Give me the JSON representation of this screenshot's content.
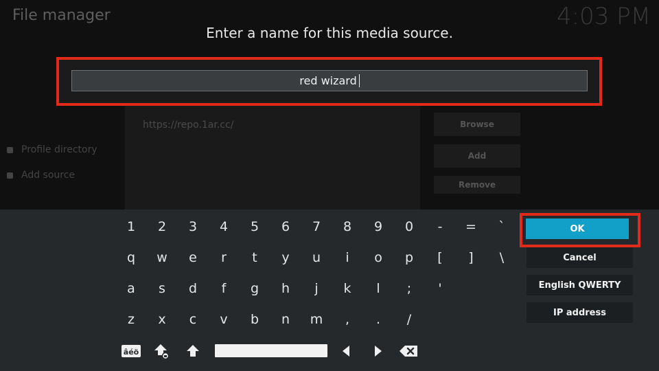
{
  "background": {
    "title": "File manager",
    "clock": "4:03 PM",
    "sidebar": [
      "Profile directory",
      "Add source"
    ],
    "source_url": "https://repo.1ar.cc/",
    "buttons": [
      "Browse",
      "Add",
      "Remove"
    ]
  },
  "dialog": {
    "heading": "Enter a name for this media source.",
    "input_value": "red wizard"
  },
  "keyboard": {
    "rows": [
      [
        "1",
        "2",
        "3",
        "4",
        "5",
        "6",
        "7",
        "8",
        "9",
        "0",
        "-",
        "=",
        "`"
      ],
      [
        "q",
        "w",
        "e",
        "r",
        "t",
        "y",
        "u",
        "i",
        "o",
        "p",
        "[",
        "]",
        "\\"
      ],
      [
        "a",
        "s",
        "d",
        "f",
        "g",
        "h",
        "j",
        "k",
        "l",
        ";",
        "'"
      ],
      [
        "z",
        "x",
        "c",
        "v",
        "b",
        "n",
        "m",
        ",",
        ".",
        "/"
      ]
    ],
    "symbols_label": "âéö"
  },
  "side_buttons": {
    "ok": "OK",
    "cancel": "Cancel",
    "layout": "English QWERTY",
    "ip": "IP address"
  },
  "colors": {
    "accent": "#12a0c8",
    "highlight": "#e12a1a",
    "panel": "#25292c"
  }
}
